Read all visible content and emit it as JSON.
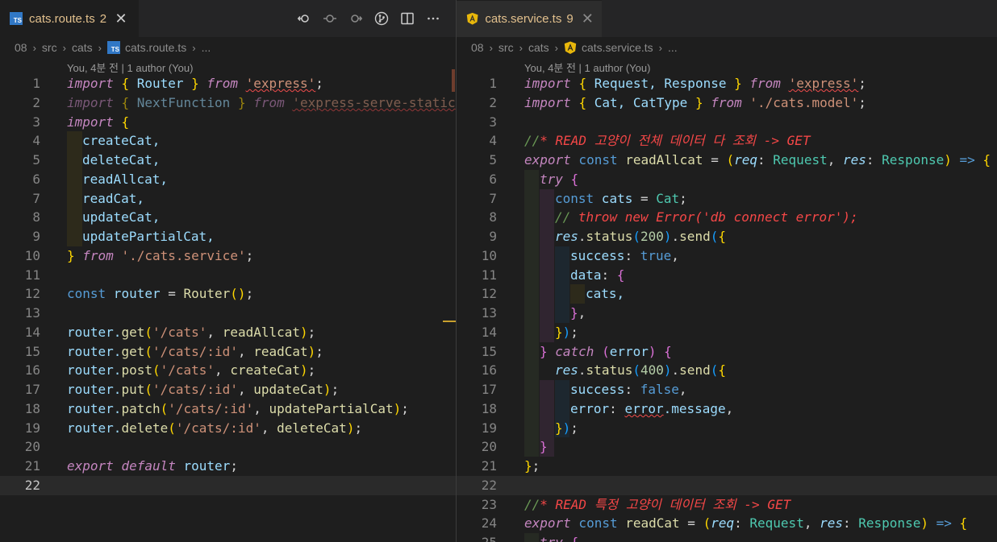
{
  "left": {
    "tab": {
      "file_name": "cats.route.ts",
      "problems": "2",
      "close": "✕"
    },
    "breadcrumb": [
      "08",
      "src",
      "cats",
      "cats.route.ts",
      "..."
    ],
    "codelens": "You, 4분 전 | 1 author (You)",
    "line_numbers": [
      "1",
      "2",
      "3",
      "4",
      "5",
      "6",
      "7",
      "8",
      "9",
      "10",
      "11",
      "12",
      "13",
      "14",
      "15",
      "16",
      "17",
      "18",
      "19",
      "20",
      "21",
      "22"
    ]
  },
  "right": {
    "tab": {
      "file_name": "cats.service.ts",
      "problems": "9",
      "close": "✕"
    },
    "breadcrumb": [
      "08",
      "src",
      "cats",
      "cats.service.ts",
      "..."
    ],
    "codelens": "You, 4분 전 | 1 author (You)",
    "line_numbers": [
      "1",
      "2",
      "3",
      "4",
      "5",
      "6",
      "7",
      "8",
      "9",
      "10",
      "11",
      "12",
      "13",
      "14",
      "15",
      "16",
      "17",
      "18",
      "19",
      "20",
      "21",
      "22",
      "23",
      "24",
      "25"
    ]
  },
  "actions": [
    "go-back-icon",
    "timeline-dot-icon",
    "go-forward-icon",
    "source-control-icon",
    "split-editor-icon",
    "more-actions-icon"
  ],
  "colors": {
    "keyword": "#569cd6",
    "control": "#c586c0",
    "string": "#ce9178",
    "function": "#dcdcaa",
    "type": "#4ec9b0",
    "variable": "#9cdcfe",
    "comment_red": "#f44747",
    "modified_tab": "#e2c08d",
    "ts_badge": "#3178c6",
    "angular_badge": "#e8b70b"
  },
  "code_left": {
    "l1_kw": "import",
    "l1_b1": "{",
    "l1_id": " Router ",
    "l1_b2": "}",
    "l1_from": "from",
    "l1_str": "'express'",
    "l1_semi": ";",
    "l2_kw": "import",
    "l2_b1": "{",
    "l2_id": " NextFunction ",
    "l2_b2": "}",
    "l2_from": "from",
    "l2_str": "'express-serve-static",
    "l3_kw": "import",
    "l3_b1": "{",
    "l4": "createCat,",
    "l5": "deleteCat,",
    "l6": "readAllcat,",
    "l7": "readCat,",
    "l8": "updateCat,",
    "l9": "updatePartialCat,",
    "l10_b": "}",
    "l10_from": "from",
    "l10_str": "'./cats.service'",
    "l10_semi": ";",
    "l12_const": "const",
    "l12_id": " router ",
    "l12_eq": "= ",
    "l12_fn": "Router",
    "l12_paren": "()",
    "l12_semi": ";",
    "l14_obj": "router.",
    "l14_fn": "get",
    "l14_p1": "(",
    "l14_str": "'/cats'",
    "l14_comma": ", ",
    "l14_arg": "readAllcat",
    "l14_p2": ")",
    "l14_semi": ";",
    "l15_obj": "router.",
    "l15_fn": "get",
    "l15_p1": "(",
    "l15_str": "'/cats/:id'",
    "l15_comma": ", ",
    "l15_arg": "readCat",
    "l15_p2": ")",
    "l15_semi": ";",
    "l16_obj": "router.",
    "l16_fn": "post",
    "l16_p1": "(",
    "l16_str": "'/cats'",
    "l16_comma": ", ",
    "l16_arg": "createCat",
    "l16_p2": ")",
    "l16_semi": ";",
    "l17_obj": "router.",
    "l17_fn": "put",
    "l17_p1": "(",
    "l17_str": "'/cats/:id'",
    "l17_comma": ", ",
    "l17_arg": "updateCat",
    "l17_p2": ")",
    "l17_semi": ";",
    "l18_obj": "router.",
    "l18_fn": "patch",
    "l18_p1": "(",
    "l18_str": "'/cats/:id'",
    "l18_comma": ", ",
    "l18_arg": "updatePartialCat",
    "l18_p2": ")",
    "l18_semi": ";",
    "l19_obj": "router.",
    "l19_fn": "delete",
    "l19_p1": "(",
    "l19_str": "'/cats/:id'",
    "l19_comma": ", ",
    "l19_arg": "deleteCat",
    "l19_p2": ")",
    "l19_semi": ";",
    "l21_export": "export",
    "l21_default": "default",
    "l21_id": " router",
    "l21_semi": ";"
  },
  "code_right": {
    "l1_kw": "import",
    "l1_b1": "{",
    "l1_id": " Request, Response ",
    "l1_b2": "}",
    "l1_from": "from",
    "l1_str": "'express'",
    "l1_semi": ";",
    "l2_kw": "import",
    "l2_b1": "{",
    "l2_id": " Cat, CatType ",
    "l2_b2": "}",
    "l2_from": "from",
    "l2_str": "'./cats.model'",
    "l2_semi": ";",
    "l4_slash": "//",
    "l4_text": "* READ 고양이 전체 데이터 다 조회 -> GET",
    "l5_export": "export",
    "l5_const": " const ",
    "l5_fn": "readAllcat",
    "l5_eq": " = ",
    "l5_p1": "(",
    "l5_req": "req",
    "l5_c1": ": ",
    "l5_t1": "Request",
    "l5_comma": ", ",
    "l5_res": "res",
    "l5_c2": ": ",
    "l5_t2": "Response",
    "l5_p2": ")",
    "l5_arrow": " => ",
    "l5_b": "{",
    "l6_try": "try",
    "l6_b": " {",
    "l7_const": "const",
    "l7_id": " cats ",
    "l7_eq": "= ",
    "l7_cls": "Cat",
    "l7_semi": ";",
    "l8_slash": "// ",
    "l8_text": "throw new Error('db connect error');",
    "l9_res": "res",
    "l9_dot1": ".",
    "l9_fn1": "status",
    "l9_p1": "(",
    "l9_num": "200",
    "l9_p2": ")",
    "l9_dot2": ".",
    "l9_fn2": "send",
    "l9_p3": "(",
    "l9_b": "{",
    "l10_key": "success",
    "l10_colon": ": ",
    "l10_val": "true",
    "l10_comma": ",",
    "l11_key": "data",
    "l11_colon": ": ",
    "l11_b": "{",
    "l12_id": "cats,",
    "l13_b": "}",
    "l13_comma": ",",
    "l14_b": "}",
    "l14_p": ")",
    "l14_semi": ";",
    "l15_b": "}",
    "l15_catch": " catch ",
    "l15_p1": "(",
    "l15_err": "error",
    "l15_p2": ")",
    "l15_b2": " {",
    "l16_res": "res",
    "l16_dot1": ".",
    "l16_fn1": "status",
    "l16_p1": "(",
    "l16_num": "400",
    "l16_p2": ")",
    "l16_dot2": ".",
    "l16_fn2": "send",
    "l16_p3": "(",
    "l16_b": "{",
    "l17_key": "success",
    "l17_colon": ": ",
    "l17_val": "false",
    "l17_comma": ",",
    "l18_key": "error",
    "l18_colon": ": ",
    "l18_obj": "error",
    "l18_prop": ".message",
    "l18_comma": ",",
    "l19_b": "}",
    "l19_p": ")",
    "l19_semi": ";",
    "l20_b": "}",
    "l21_b": "}",
    "l21_semi": ";",
    "l23_slash": "//",
    "l23_text": "* READ 특정 고양이 데이터 조회 -> GET",
    "l24_export": "export",
    "l24_const": " const ",
    "l24_fn": "readCat",
    "l24_eq": " = ",
    "l24_p1": "(",
    "l24_req": "req",
    "l24_c1": ": ",
    "l24_t1": "Request",
    "l24_comma": ", ",
    "l24_res": "res",
    "l24_c2": ": ",
    "l24_t2": "Response",
    "l24_p2": ")",
    "l24_arrow": " => ",
    "l24_b": "{",
    "l25_try": "try",
    "l25_b": " {"
  }
}
